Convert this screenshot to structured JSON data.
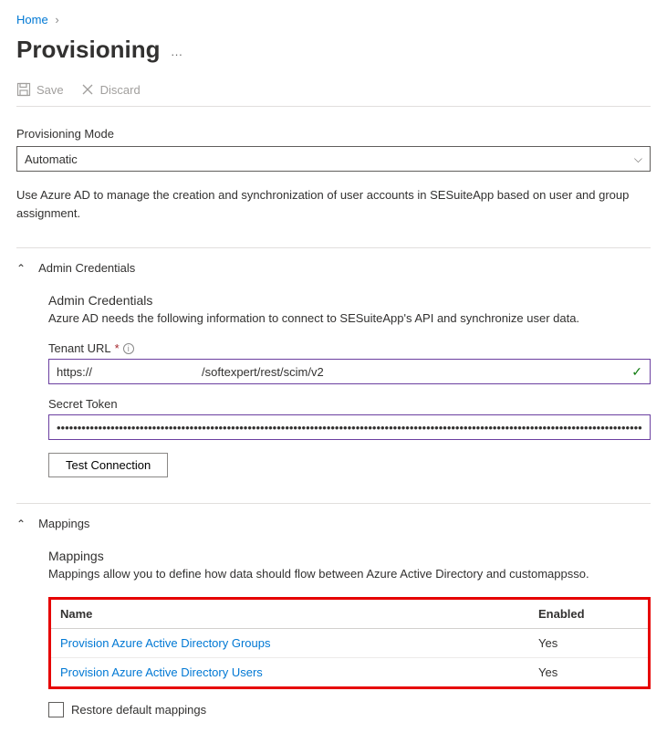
{
  "breadcrumb": {
    "home": "Home"
  },
  "page_title": "Provisioning",
  "toolbar": {
    "save": "Save",
    "discard": "Discard"
  },
  "prov_mode": {
    "label": "Provisioning Mode",
    "value": "Automatic"
  },
  "description": "Use Azure AD to manage the creation and synchronization of user accounts in SESuiteApp based on user and group assignment.",
  "admin": {
    "header": "Admin Credentials",
    "subhead": "Admin Credentials",
    "subdesc": "Azure AD needs the following information to connect to SESuiteApp's API and synchronize user data.",
    "tenant_label": "Tenant URL",
    "tenant_prefix": "https://",
    "tenant_suffix": "/softexpert/rest/scim/v2",
    "secret_label": "Secret Token",
    "secret_value": "••••••••••••••••••••••••••••••••••••••••••••••••••••••••••••••••••••••••••••••••••••••••••••••••••••••••••••••••••••••••••••••••••••••••••••••••••••••••••••••••••••••...",
    "test_btn": "Test Connection"
  },
  "mappings": {
    "header": "Mappings",
    "subhead": "Mappings",
    "subdesc": "Mappings allow you to define how data should flow between Azure Active Directory and customappsso.",
    "col_name": "Name",
    "col_enabled": "Enabled",
    "rows": [
      {
        "name": "Provision Azure Active Directory Groups",
        "enabled": "Yes"
      },
      {
        "name": "Provision Azure Active Directory Users",
        "enabled": "Yes"
      }
    ],
    "restore": "Restore default mappings"
  }
}
